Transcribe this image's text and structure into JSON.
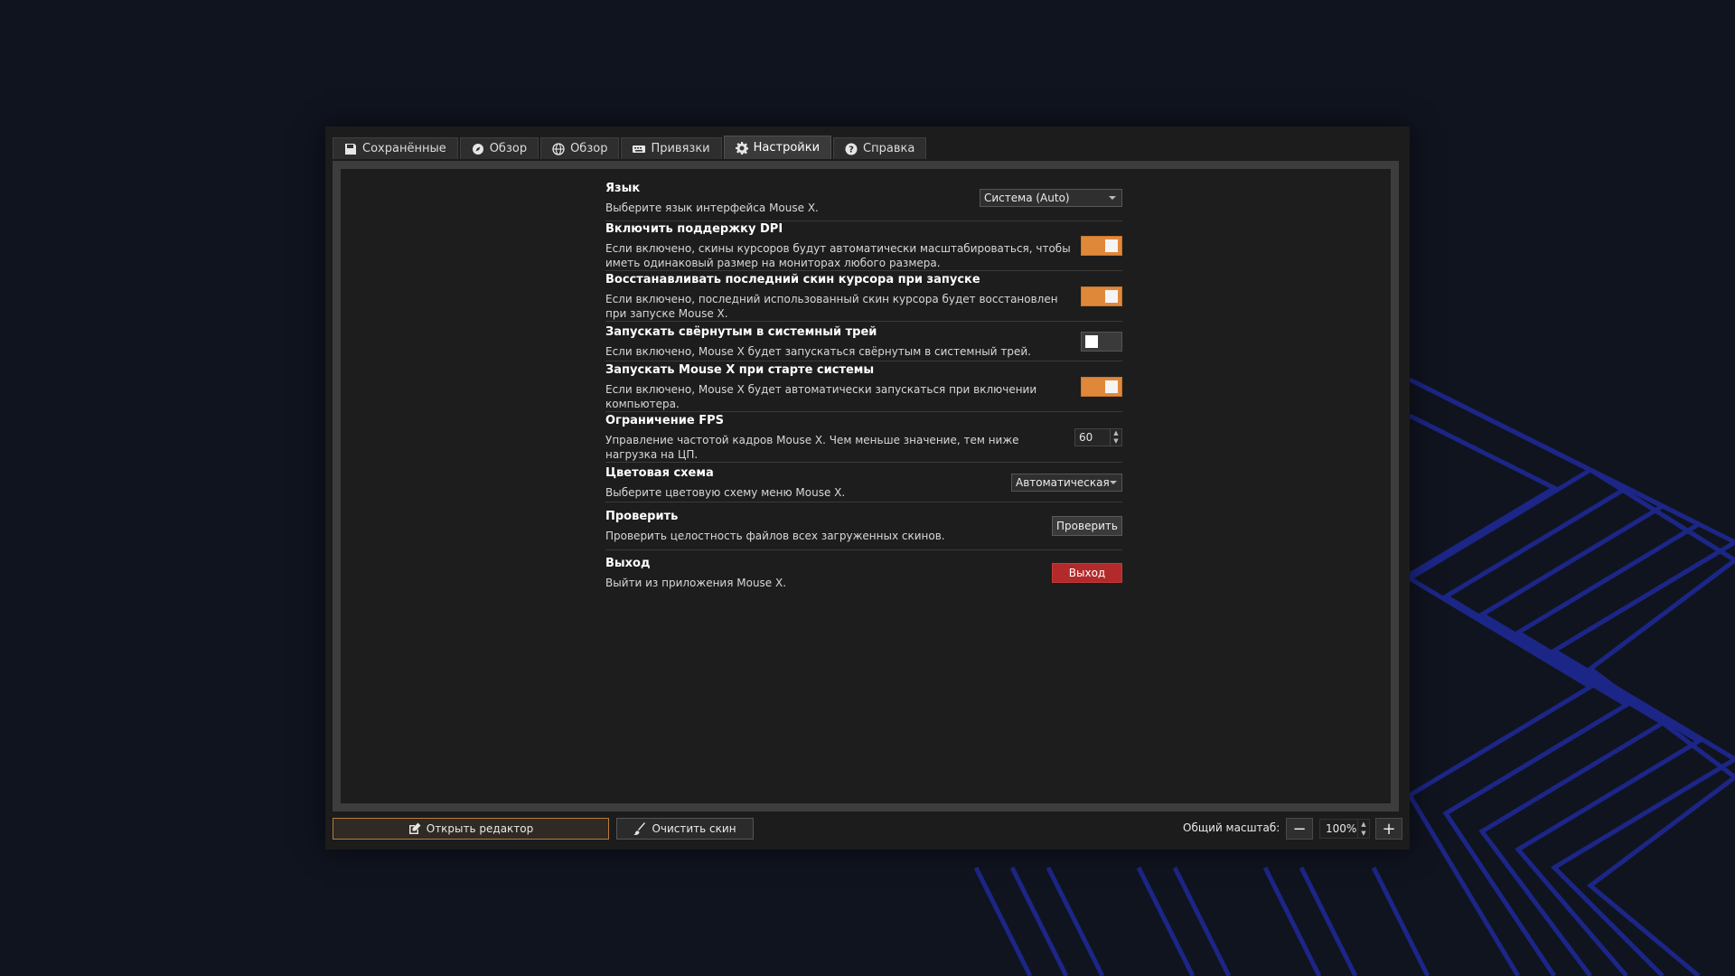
{
  "tabs": [
    {
      "label": "Сохранённые",
      "icon": "save-icon",
      "active": false
    },
    {
      "label": "Обзор",
      "icon": "compass-icon",
      "active": false
    },
    {
      "label": "Обзор",
      "icon": "globe-icon",
      "active": false
    },
    {
      "label": "Привязки",
      "icon": "keyboard-icon",
      "active": false
    },
    {
      "label": "Настройки",
      "icon": "gear-icon",
      "active": true
    },
    {
      "label": "Справка",
      "icon": "help-icon",
      "active": false
    }
  ],
  "settings": {
    "language": {
      "title": "Язык",
      "desc": "Выберите язык интерфейса Mouse X.",
      "value": "Система (Auto)"
    },
    "dpi": {
      "title": "Включить поддержку DPI",
      "desc": "Если включено, скины курсоров будут автоматически масштабироваться, чтобы иметь одинаковый размер на мониторах любого размера.",
      "enabled": true
    },
    "restore_skin": {
      "title": "Восстанавливать последний скин курсора при запуске",
      "desc": "Если включено, последний использованный скин курсора будет восстановлен при запуске Mouse X.",
      "enabled": true
    },
    "start_minimized": {
      "title": "Запускать свёрнутым в системный трей",
      "desc": "Если включено, Mouse X будет запускаться свёрнутым в системный трей.",
      "enabled": false
    },
    "autostart": {
      "title": "Запускать Mouse X при старте системы",
      "desc": "Если включено, Mouse X будет автоматически запускаться при включении компьютера.",
      "enabled": true
    },
    "fps": {
      "title": "Ограничение FPS",
      "desc": "Управление частотой кадров Mouse X. Чем меньше значение, тем ниже нагрузка на ЦП.",
      "value": "60"
    },
    "theme": {
      "title": "Цветовая схема",
      "desc": "Выберите цветовую схему меню Mouse X.",
      "value": "Автоматическая"
    },
    "verify": {
      "title": "Проверить",
      "desc": "Проверить целостность файлов всех загруженных скинов.",
      "button": "Проверить"
    },
    "exit": {
      "title": "Выход",
      "desc": "Выйти из приложения Mouse X.",
      "button": "Выход"
    }
  },
  "footer": {
    "open_editor": "Открыть редактор",
    "clear_skin": "Очистить скин",
    "zoom_label": "Общий масштаб:",
    "zoom_value": "100%"
  },
  "colors": {
    "accent": "#e0883a",
    "danger": "#b22a2a",
    "background": "#10141f",
    "stripe": "#1f2a9a"
  }
}
